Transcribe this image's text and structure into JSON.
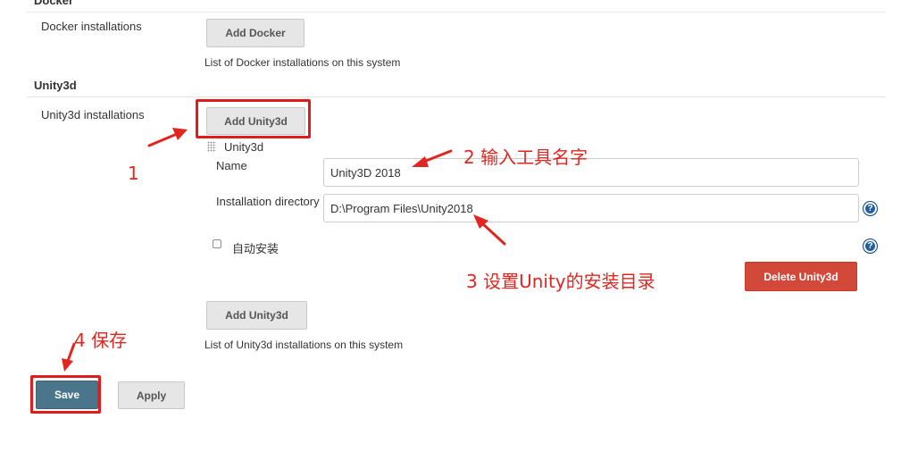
{
  "docker": {
    "section_title": "Docker",
    "installations_label": "Docker installations",
    "add_button": "Add Docker",
    "description": "List of Docker installations on this system"
  },
  "unity": {
    "section_title": "Unity3d",
    "installations_label": "Unity3d installations",
    "add_button_top": "Add Unity3d",
    "item": {
      "header": "Unity3d",
      "name_label": "Name",
      "name_value": "Unity3D 2018",
      "dir_label": "Installation directory",
      "dir_value": "D:\\Program Files\\Unity2018",
      "auto_install_label": "自动安装",
      "auto_install_checked": false,
      "delete_button": "Delete Unity3d"
    },
    "add_button_bottom": "Add Unity3d",
    "description": "List of Unity3d installations on this system"
  },
  "actions": {
    "save_label": "Save",
    "apply_label": "Apply"
  },
  "annotations": {
    "step1": "1",
    "step2": "2 输入工具名字",
    "step3": "3 设置Unity的安装目录",
    "step4": "4 保存"
  },
  "colors": {
    "annotation_red": "#e2261f",
    "save_blue": "#4b758b",
    "delete_red": "#d24939",
    "help_blue": "#1f5fa8"
  },
  "icons": {
    "help": "question-mark-circle-icon",
    "drag": "drag-handle-icon"
  }
}
